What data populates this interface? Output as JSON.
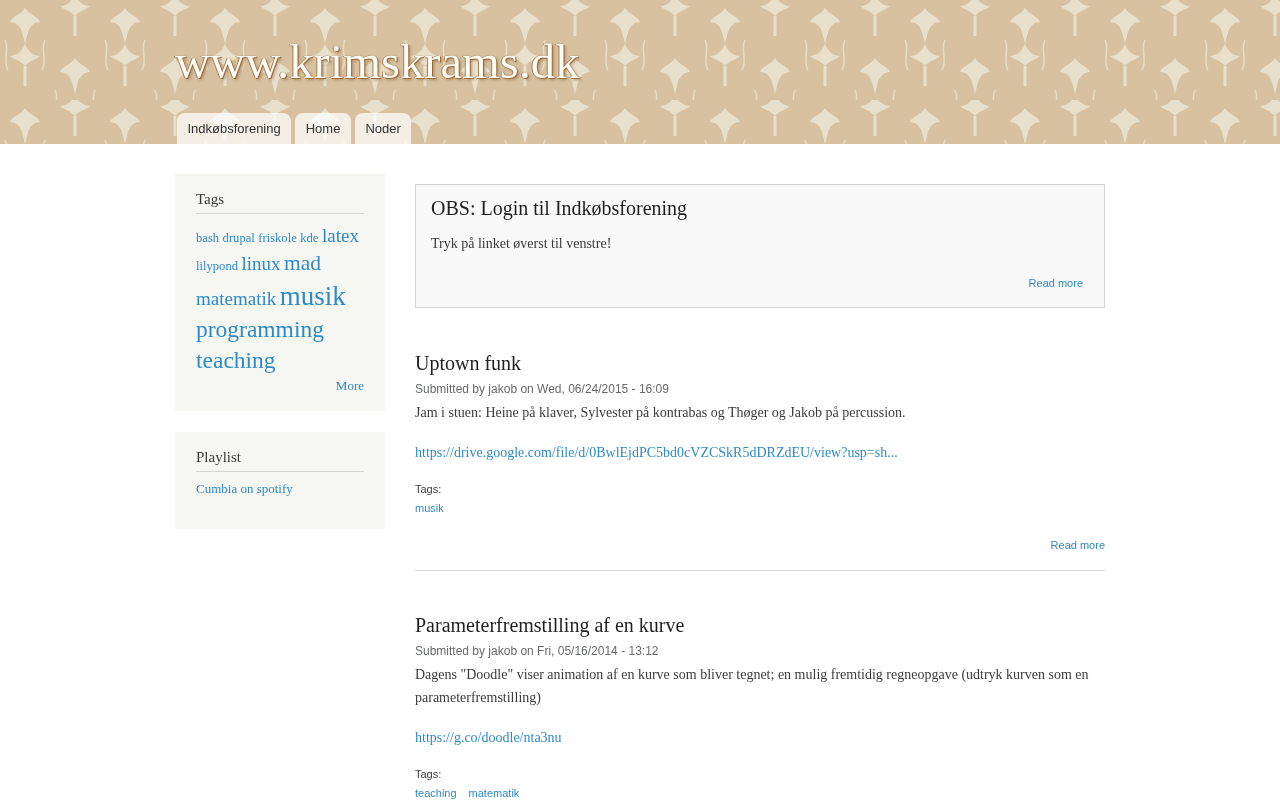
{
  "header": {
    "site_title": "www.krimskrams.dk",
    "tabs": [
      {
        "label": "Indkøbsforening"
      },
      {
        "label": "Home"
      },
      {
        "label": "Noder"
      }
    ]
  },
  "sidebar": [
    {
      "kind": "tag_cloud",
      "title": "Tags",
      "tags": [
        {
          "label": "bash",
          "kind": "level1"
        },
        {
          "label": "drupal",
          "kind": "level1"
        },
        {
          "label": "friskole",
          "kind": "level1"
        },
        {
          "label": "kde",
          "kind": "level1"
        },
        {
          "label": "latex",
          "kind": "level3"
        },
        {
          "label": "lilypond",
          "kind": "level1"
        },
        {
          "label": "linux",
          "kind": "level3"
        },
        {
          "label": "mad",
          "kind": "level4"
        },
        {
          "label": "matematik",
          "kind": "level3"
        },
        {
          "label": "musik",
          "kind": "level6"
        },
        {
          "label": "programming",
          "kind": "level5"
        },
        {
          "label": "teaching",
          "kind": "level5"
        }
      ],
      "more": "More"
    },
    {
      "kind": "link_list",
      "title": "Playlist",
      "links": [
        "Cumbia on spotify"
      ]
    }
  ],
  "sticky_post": {
    "title": "OBS: Login til Indkøbsforening",
    "body": "Tryk på linket øverst til venstre!",
    "read_more": "Read more"
  },
  "articles": [
    {
      "title": "Uptown funk",
      "submitted": "Submitted by jakob on Wed, 06/24/2015 - 16:09",
      "body": "Jam i stuen: Heine på klaver, Sylvester på kontrabas og Thøger og Jakob på percussion.",
      "link": "https://drive.google.com/file/d/0BwlEjdPC5bd0cVZCSkR5dDRZdEU/view?usp=sh...",
      "tags_label": "Tags:",
      "tags": [
        "musik"
      ],
      "read_more": "Read more"
    },
    {
      "title": "Parameterfremstilling af en kurve",
      "submitted": "Submitted by jakob on Fri, 05/16/2014 - 13:12",
      "body": "Dagens \"Doodle\" viser animation af en kurve som bliver tegnet; en mulig fremtidig regneopgave (udtryk kurven som en parameterfremstilling)",
      "link": "https://g.co/doodle/nta3nu",
      "tags_label": "Tags:",
      "tags": [
        "teaching",
        "matematik"
      ]
    }
  ]
}
